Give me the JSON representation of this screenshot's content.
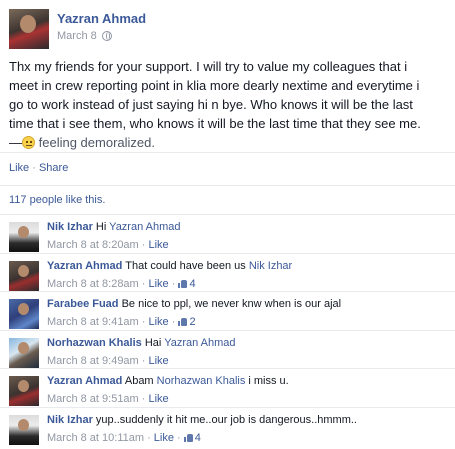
{
  "post": {
    "author": "Yazran Ahmad",
    "date": "March 8",
    "text_lines": [
      "Thx my friends for your support. I will try to value my colleagues that i",
      "meet in crew reporting point in klia more dearly nextime and everytime i",
      "go to work instead of just saying hi n bye. Who knows it will be the last",
      "time that i see them, who knows it will be the last time that they see me."
    ],
    "feeling_prefix": "—",
    "feeling_text": "feeling demoralized."
  },
  "actions": {
    "like": "Like",
    "separator": " · ",
    "share": "Share"
  },
  "likes_summary": "117 people like this.",
  "comments": [
    {
      "author": "Nik Izhar",
      "text": "Hi",
      "mention": "Yazran Ahmad",
      "text_after": "",
      "time": "March 8 at 8:20am",
      "like": "Like",
      "like_count": ""
    },
    {
      "author": "Yazran Ahmad",
      "text": "That could have been us",
      "mention": "Nik Izhar",
      "text_after": "",
      "time": "March 8 at 8:28am",
      "like": "Like",
      "like_count": "4"
    },
    {
      "author": "Farabee Fuad",
      "text": "Be nice to ppl, we never knw when is our ajal",
      "mention": "",
      "text_after": "",
      "time": "March 8 at 9:41am",
      "like": "Like",
      "like_count": "2"
    },
    {
      "author": "Norhazwan Khalis",
      "text": "Hai",
      "mention": "Yazran Ahmad",
      "text_after": "",
      "time": "March 8 at 9:49am",
      "like": "Like",
      "like_count": ""
    },
    {
      "author": "Yazran Ahmad",
      "text": "Abam",
      "mention": "Norhazwan Khalis",
      "text_after": "i miss u.",
      "time": "March 8 at 9:51am",
      "like": "Like",
      "like_count": ""
    },
    {
      "author": "Nik Izhar",
      "text": "yup..suddenly it hit me..our job is dangerous..hmmm..",
      "mention": "",
      "text_after": "",
      "time": "March 8 at 10:11am",
      "like": "Like",
      "like_count": "4"
    }
  ],
  "meta_separator": " · ",
  "colors": {
    "link": "#3b5998",
    "meta": "#9197a3",
    "text": "#141823",
    "divider": "#e9eaed"
  },
  "icons": {
    "audience": "globe-icon",
    "feeling": "sad-emoji-icon",
    "like_count": "thumbs-up-icon"
  }
}
